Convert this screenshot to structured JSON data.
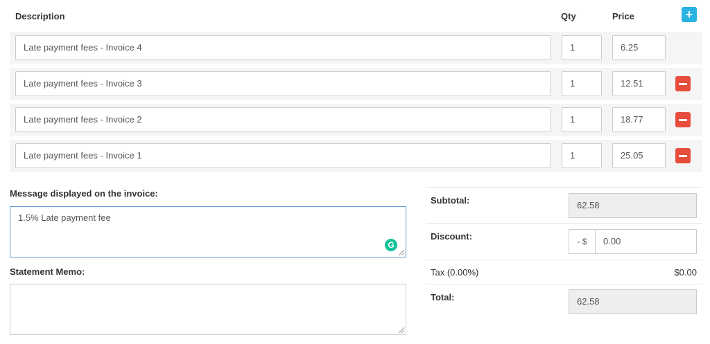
{
  "header": {
    "description": "Description",
    "qty": "Qty",
    "price": "Price",
    "add_icon": "plus-icon"
  },
  "line_items": [
    {
      "description": "Late payment fees - Invoice 4",
      "qty": "1",
      "price": "6.25",
      "removable": false
    },
    {
      "description": "Late payment fees - Invoice 3",
      "qty": "1",
      "price": "12.51",
      "removable": true
    },
    {
      "description": "Late payment fees - Invoice 2",
      "qty": "1",
      "price": "18.77",
      "removable": true
    },
    {
      "description": "Late payment fees - Invoice 1",
      "qty": "1",
      "price": "25.05",
      "removable": true
    }
  ],
  "message": {
    "label": "Message displayed on the invoice:",
    "value": "1.5% Late payment fee",
    "assistant_icon": "grammarly-icon"
  },
  "memo": {
    "label": "Statement Memo:",
    "value": ""
  },
  "totals": {
    "subtotal_label": "Subtotal:",
    "subtotal_value": "62.58",
    "discount_label": "Discount:",
    "discount_prefix": "- $",
    "discount_value": "0.00",
    "tax_label": "Tax (0.00%)",
    "tax_value": "$0.00",
    "total_label": "Total:",
    "total_value": "62.58"
  },
  "colors": {
    "add_button": "#29b3e3",
    "remove_button": "#e74c3c",
    "focus_border": "#5b9bd5",
    "grammarly": "#15c39a"
  }
}
